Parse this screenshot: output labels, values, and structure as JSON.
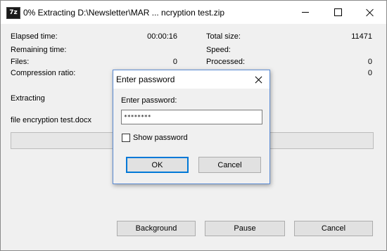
{
  "window": {
    "icon_text": "7z",
    "title": "0% Extracting D:\\Newsletter\\MAR ... ncryption test.zip"
  },
  "stats": {
    "elapsed_label": "Elapsed time:",
    "elapsed_value": "00:00:16",
    "remaining_label": "Remaining time:",
    "files_label": "Files:",
    "files_value": "0",
    "compression_label": "Compression ratio:",
    "total_size_label": "Total size:",
    "total_size_value": "11471",
    "speed_label": "Speed:",
    "processed_label": "Processed:",
    "processed_value": "0",
    "extra_value": "0"
  },
  "status": {
    "action": "Extracting",
    "current_file": "file encryption test.docx",
    "progress_percent": 0
  },
  "buttons": {
    "background": "Background",
    "pause": "Pause",
    "cancel": "Cancel"
  },
  "dialog": {
    "title": "Enter password",
    "prompt": "Enter password:",
    "password_value": "********",
    "show_password_label": "Show password",
    "show_password_checked": false,
    "ok": "OK",
    "cancel": "Cancel"
  }
}
